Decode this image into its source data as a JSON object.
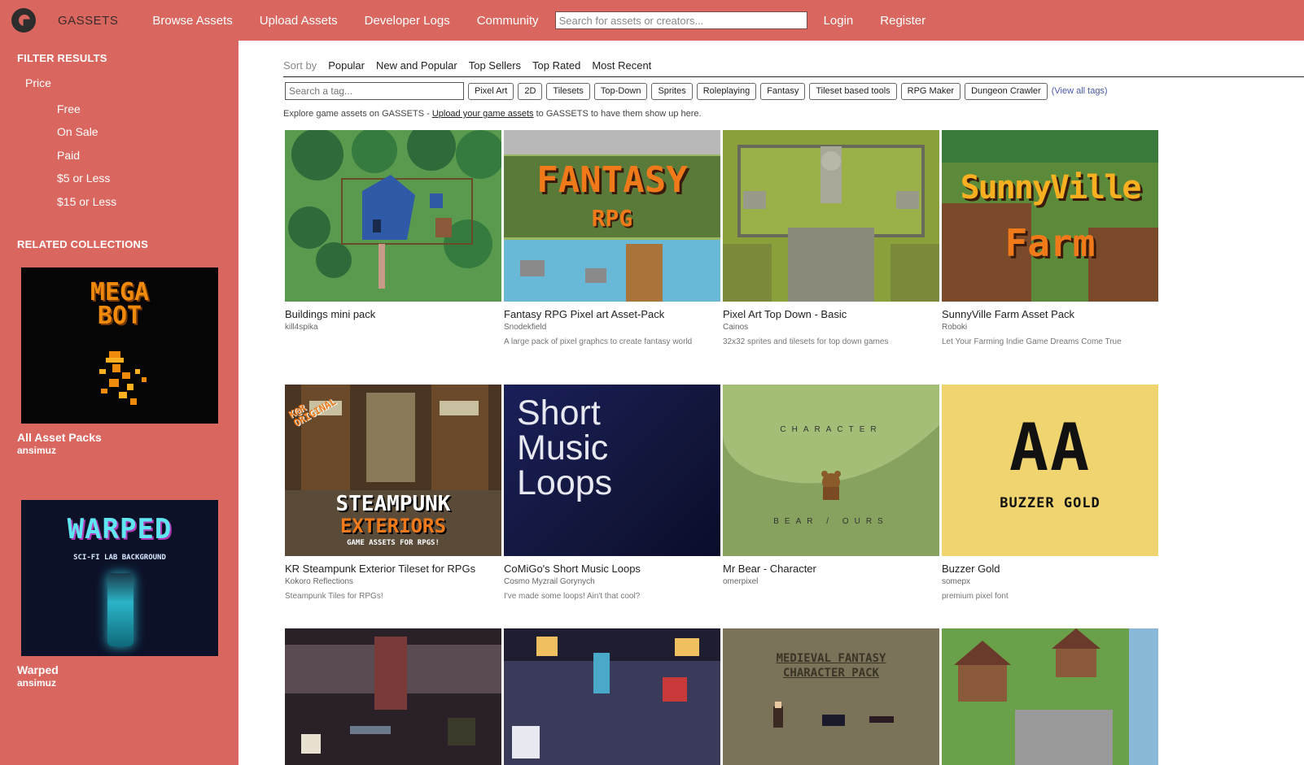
{
  "header": {
    "brand": "GASSETS",
    "nav": [
      "Browse Assets",
      "Upload Assets",
      "Developer Logs",
      "Community"
    ],
    "search_placeholder": "Search for assets or creators...",
    "login": "Login",
    "register": "Register"
  },
  "sidebar": {
    "filter_heading": "FILTER RESULTS",
    "price_label": "Price",
    "price_options": [
      "Free",
      "On Sale",
      "Paid",
      "$5 or Less",
      "$15 or Less"
    ],
    "collections_heading": "RELATED COLLECTIONS",
    "collections": [
      {
        "title": "All Asset Packs",
        "author": "ansimuz",
        "art": {
          "line1": "MEGA",
          "line2": "BOT"
        }
      },
      {
        "title": "Warped",
        "author": "ansimuz",
        "art": {
          "title": "WARPED",
          "subtitle": "SCI-FI LAB BACKGROUND"
        }
      }
    ]
  },
  "sort": {
    "label": "Sort by",
    "options": [
      "Popular",
      "New and Popular",
      "Top Sellers",
      "Top Rated",
      "Most Recent"
    ]
  },
  "tags": {
    "search_placeholder": "Search a tag...",
    "items": [
      "Pixel Art",
      "2D",
      "Tilesets",
      "Top-Down",
      "Sprites",
      "Roleplaying",
      "Fantasy",
      "Tileset based tools",
      "RPG Maker",
      "Dungeon Crawler"
    ],
    "view_all": "(View all tags)"
  },
  "explore": {
    "prefix": "Explore game assets on GASSETS - ",
    "link": "Upload your game assets",
    "suffix": " to GASSETS to have them show up here."
  },
  "assets": [
    {
      "title": "Buildings mini pack",
      "author": "kill4spika",
      "desc": ""
    },
    {
      "title": "Fantasy RPG Pixel art Asset-Pack",
      "author": "Snodekfield",
      "desc": "A large pack of pixel graphcs to create fantasy world",
      "art": {
        "line1": "FANTASY",
        "line2": "RPG"
      }
    },
    {
      "title": "Pixel Art Top Down - Basic",
      "author": "Cainos",
      "desc": "32x32 sprites and tilesets for top down games"
    },
    {
      "title": "SunnyVille Farm Asset Pack",
      "author": "Roboki",
      "desc": "Let Your Farming Indie Game Dreams Come True",
      "art": {
        "line1": "SunnyVille",
        "line2": "Farm"
      }
    },
    {
      "title": "KR Steampunk Exterior Tileset for RPGs",
      "author": "Kokoro Reflections",
      "desc": "Steampunk Tiles for RPGs!",
      "art": {
        "badge": "K@R ORIGINAL",
        "line1": "STEAMPUNK",
        "line2": "EXTERIORS",
        "line3": "GAME ASSETS FOR RPGS!"
      }
    },
    {
      "title": "CoMiGo's Short Music Loops",
      "author": "Cosmo Myzrail Gorynych",
      "desc": "I've made some loops! Ain't that cool?",
      "art": {
        "line1": "Short",
        "line2": "Music",
        "line3": "Loops"
      }
    },
    {
      "title": "Mr Bear - Character",
      "author": "omerpixel",
      "desc": "",
      "art": {
        "top": "CHARACTER",
        "bottom": "BEAR / OURS"
      }
    },
    {
      "title": "Buzzer Gold",
      "author": "somepx",
      "desc": "premium pixel font",
      "art": {
        "big": "AA",
        "caption": "BUZZER GOLD"
      }
    },
    {
      "title": "",
      "author": "",
      "desc": ""
    },
    {
      "title": "",
      "author": "",
      "desc": ""
    },
    {
      "title": "",
      "author": "",
      "desc": "",
      "art": {
        "line1": "MEDIEVAL FANTASY",
        "line2": "CHARACTER PACK"
      }
    },
    {
      "title": "",
      "author": "",
      "desc": ""
    }
  ],
  "colors": {
    "accent": "#d9675f",
    "text_dark": "#222222"
  }
}
